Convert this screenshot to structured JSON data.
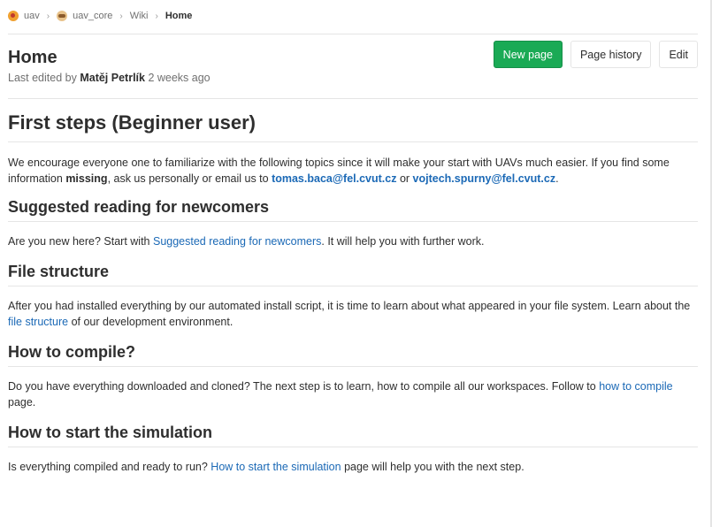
{
  "breadcrumb": {
    "group": "uav",
    "project": "uav_core",
    "section": "Wiki",
    "current": "Home"
  },
  "header": {
    "title": "Home",
    "last_edited_prefix": "Last edited by",
    "author": "Matěj Petrlík",
    "time_ago": "2 weeks ago",
    "buttons": {
      "new_page": "New page",
      "page_history": "Page history",
      "edit": "Edit"
    }
  },
  "content": {
    "first_steps": {
      "heading": "First steps (Beginner user)",
      "text_1": "We encourage everyone one to familiarize with the following topics since it will make your start with UAVs much easier. If you find some information ",
      "bold_word": "missing",
      "text_2": ", ask us personally or email us to ",
      "email_1": "tomas.baca@fel.cvut.cz",
      "or": " or ",
      "email_2": "vojtech.spurny@fel.cvut.cz",
      "end": "."
    },
    "suggested_reading": {
      "heading": "Suggested reading for newcomers",
      "text_1": "Are you new here? Start with ",
      "link": "Suggested reading for newcomers",
      "text_2": ". It will help you with further work."
    },
    "file_structure": {
      "heading": "File structure",
      "text_1": "After you had installed everything by our automated install script, it is time to learn about what appeared in your file system. Learn about the ",
      "link": "file structure",
      "text_2": " of our development environment."
    },
    "compile": {
      "heading": "How to compile?",
      "text_1": "Do you have everything downloaded and cloned? The next step is to learn, how to compile all our workspaces. Follow to ",
      "link": "how to compile",
      "text_2": " page."
    },
    "simulation": {
      "heading": "How to start the simulation",
      "text_1": "Is everything compiled and ready to run? ",
      "link": "How to start the simulation",
      "text_2": " page will help you with the next step."
    }
  },
  "colors": {
    "link": "#1b69b6",
    "primary_button": "#1aaa55",
    "border": "#e5e5e5",
    "text": "#2e2e2e",
    "muted": "#707070"
  }
}
